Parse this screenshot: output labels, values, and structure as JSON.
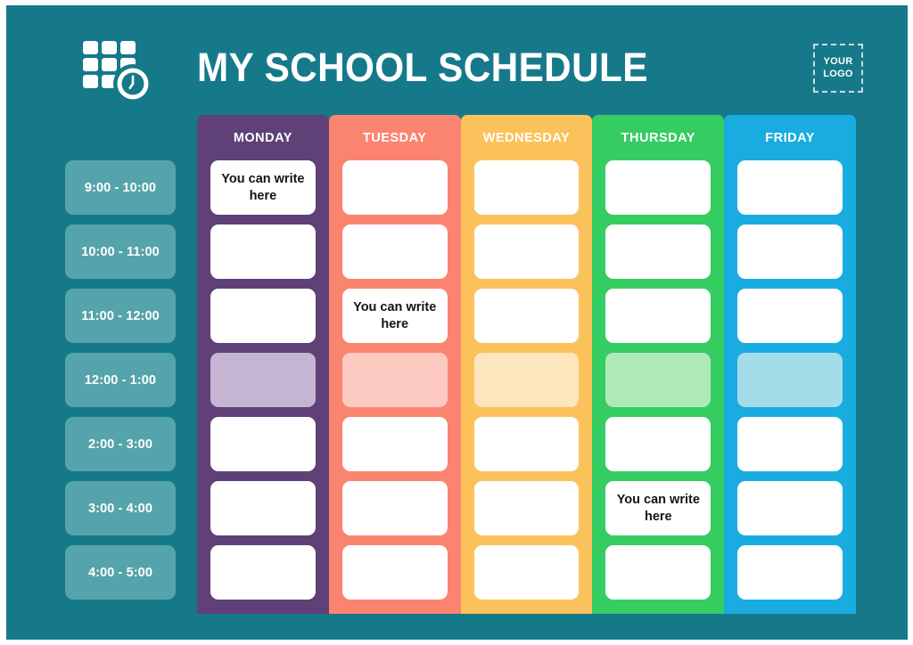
{
  "header": {
    "title": "MY SCHOOL SCHEDULE",
    "logo_placeholder": {
      "line1": "YOUR",
      "line2": "LOGO"
    },
    "logo_icon": "calendar-clock-icon"
  },
  "colors": {
    "background": "#16798a",
    "page_border": "#ffffff",
    "time_pill": "#56a4ab",
    "monday": "#5f4177",
    "tuesday": "#fa8470",
    "wednesday": "#fbc25c",
    "thursday": "#35cc62",
    "friday": "#19ace0",
    "monday_tint": "#c5b5d3",
    "tuesday_tint": "#fdcac1",
    "wednesday_tint": "#fde6bd",
    "thursday_tint": "#aeeab8",
    "friday_tint": "#a5dcea",
    "cell": "#ffffff",
    "cell_text": "#141414",
    "header_text": "#ffffff"
  },
  "time_slots": [
    "9:00 - 10:00",
    "10:00 - 11:00",
    "11:00 - 12:00",
    "12:00 - 1:00",
    "2:00 - 3:00",
    "3:00 - 4:00",
    "4:00 - 5:00"
  ],
  "placeholder_text": "You can write here",
  "days": [
    {
      "label": "MONDAY",
      "color": "#5f4177",
      "tint": "#c5b5d3",
      "cells": [
        {
          "text": "You can write here",
          "style": "filled"
        },
        {
          "text": "",
          "style": "empty"
        },
        {
          "text": "",
          "style": "empty"
        },
        {
          "text": "",
          "style": "tinted"
        },
        {
          "text": "",
          "style": "empty"
        },
        {
          "text": "",
          "style": "empty"
        },
        {
          "text": "",
          "style": "empty"
        }
      ]
    },
    {
      "label": "TUESDAY",
      "color": "#fa8470",
      "tint": "#fdcac1",
      "cells": [
        {
          "text": "",
          "style": "empty"
        },
        {
          "text": "",
          "style": "empty"
        },
        {
          "text": "You can write here",
          "style": "filled"
        },
        {
          "text": "",
          "style": "tinted"
        },
        {
          "text": "",
          "style": "empty"
        },
        {
          "text": "",
          "style": "empty"
        },
        {
          "text": "",
          "style": "empty"
        }
      ]
    },
    {
      "label": "WEDNESDAY",
      "color": "#fbc25c",
      "tint": "#fde6bd",
      "cells": [
        {
          "text": "",
          "style": "empty"
        },
        {
          "text": "",
          "style": "empty"
        },
        {
          "text": "",
          "style": "empty"
        },
        {
          "text": "",
          "style": "tinted"
        },
        {
          "text": "",
          "style": "empty"
        },
        {
          "text": "",
          "style": "empty"
        },
        {
          "text": "",
          "style": "empty"
        }
      ]
    },
    {
      "label": "THURSDAY",
      "color": "#35cc62",
      "tint": "#aeeab8",
      "cells": [
        {
          "text": "",
          "style": "empty"
        },
        {
          "text": "",
          "style": "empty"
        },
        {
          "text": "",
          "style": "empty"
        },
        {
          "text": "",
          "style": "tinted"
        },
        {
          "text": "",
          "style": "empty"
        },
        {
          "text": "You can write here",
          "style": "filled"
        },
        {
          "text": "",
          "style": "empty"
        }
      ]
    },
    {
      "label": "FRIDAY",
      "color": "#19ace0",
      "tint": "#a5dcea",
      "cells": [
        {
          "text": "",
          "style": "empty"
        },
        {
          "text": "",
          "style": "empty"
        },
        {
          "text": "",
          "style": "empty"
        },
        {
          "text": "",
          "style": "tinted"
        },
        {
          "text": "",
          "style": "empty"
        },
        {
          "text": "",
          "style": "empty"
        },
        {
          "text": "",
          "style": "empty"
        }
      ]
    }
  ]
}
